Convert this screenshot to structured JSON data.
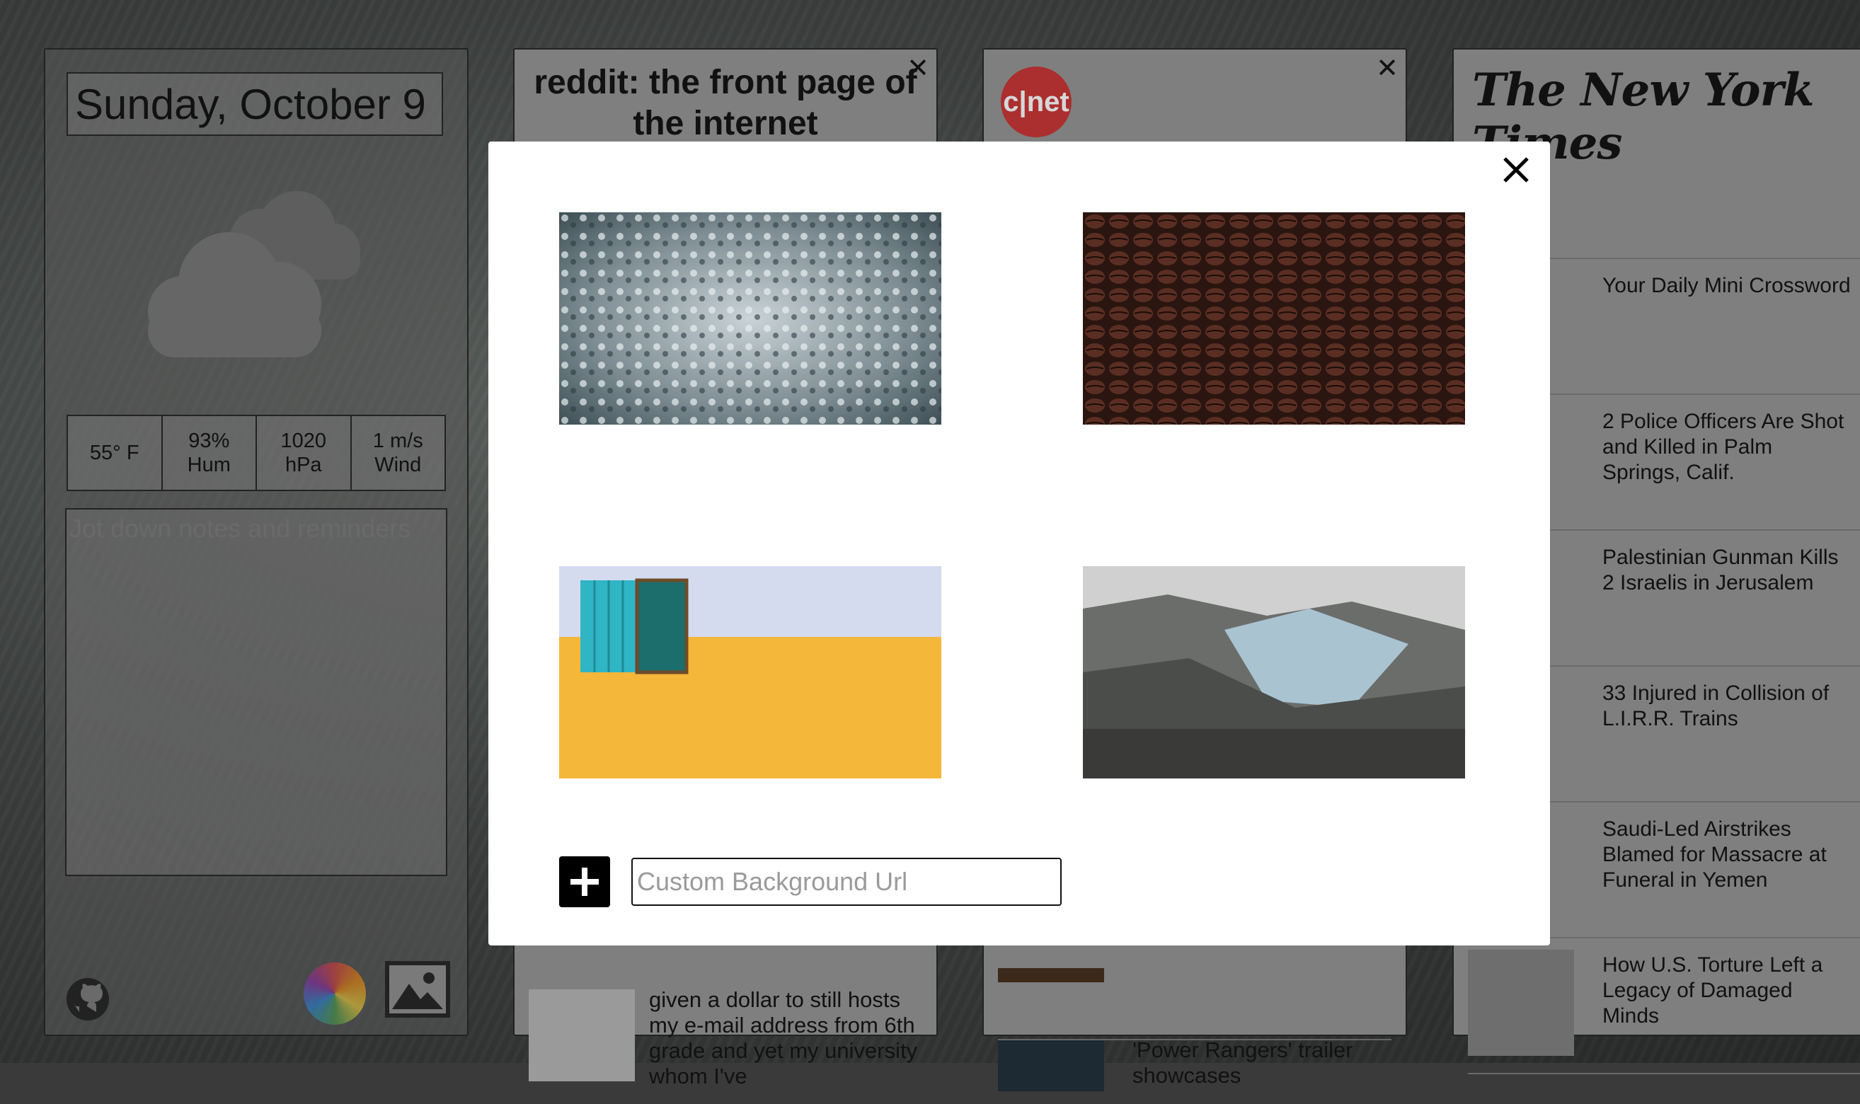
{
  "dashboard": {
    "date": "Sunday, October 9",
    "weather": {
      "icon": "partly-cloudy-icon",
      "stats": [
        "55° F",
        "93%\nHum",
        "1020\nhPa",
        "1 m/s\nWind"
      ]
    },
    "notes_placeholder": "Jot down notes and reminders",
    "footer_icons": [
      "github-icon",
      "color-wheel-icon",
      "image-icon"
    ]
  },
  "reddit": {
    "title": "reddit: the front page of the internet",
    "visible_post": "given a dollar to still hosts my e-mail address from 6th grade and yet my university whom I've"
  },
  "cnet": {
    "logo_text": "c|net",
    "items": [
      "'Power Rangers' trailer showcases"
    ]
  },
  "nyt": {
    "logo_text": "The New York Times",
    "items": [
      "Your Daily Mini Crossword",
      "2 Police Officers Are Shot and Killed in Palm Springs, Calif.",
      "Palestinian Gunman Kills 2 Israelis in Jerusalem",
      "33 Injured in Collision of L.I.R.R. Trains",
      "Saudi-Led Airstrikes Blamed for Massacre at Funeral in Yemen",
      "How U.S. Torture Left a Legacy of Damaged Minds"
    ]
  },
  "modal": {
    "close_icon": "close-icon",
    "backgrounds": [
      "snowy-forest-aerial",
      "coffee-beans",
      "turquoise-window-yellow-wall",
      "glacier-valley"
    ],
    "add_icon": "plus-icon",
    "custom_url_placeholder": "Custom Background Url",
    "custom_url_value": ""
  }
}
